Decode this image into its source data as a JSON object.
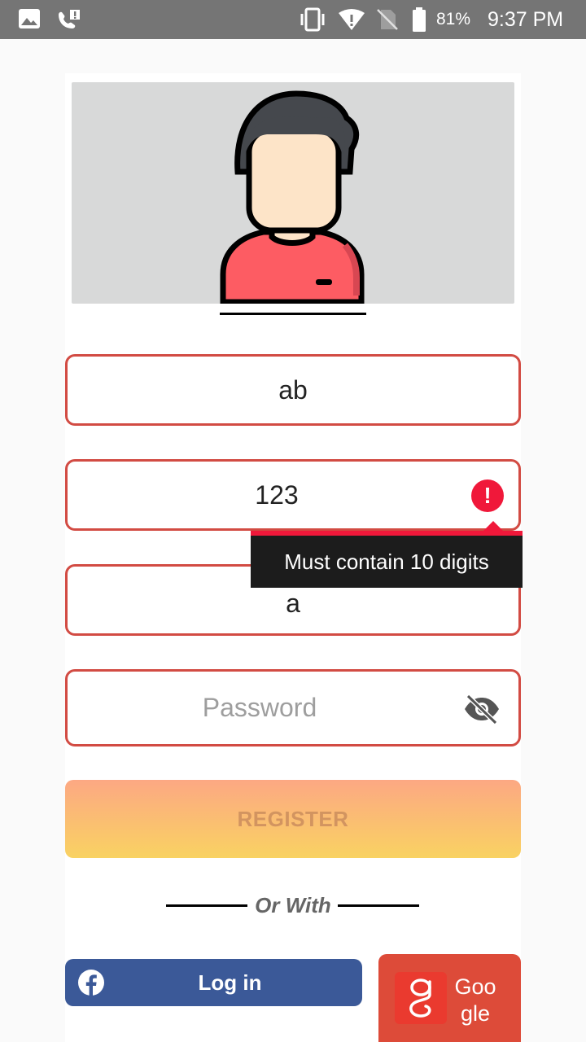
{
  "status_bar": {
    "battery": "81%",
    "time": "9:37 PM"
  },
  "form": {
    "name_value": "ab",
    "phone_value": "123",
    "phone_error": "Must contain 10 digits",
    "third_value": "a",
    "password_placeholder": "Password"
  },
  "buttons": {
    "register": "REGISTER",
    "or_with": "Or With",
    "facebook": "Log in",
    "google": "Google"
  },
  "colors": {
    "field_border": "#d24b43",
    "error": "#f0183a",
    "facebook": "#3b5998",
    "google": "#dd4b39",
    "register_top": "#fca883",
    "register_bottom": "#f9d262"
  }
}
